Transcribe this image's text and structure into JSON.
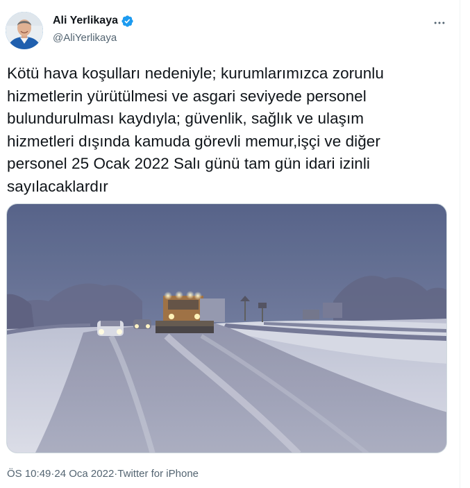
{
  "author": {
    "display_name": "Ali Yerlikaya",
    "handle": "@AliYerlikaya",
    "verified": true
  },
  "tweet": {
    "text": "Kötü hava koşulları nedeniyle; kurumlarımızca zorunlu\nhizmetlerin yürütülmesi ve asgari seviyede personel\nbulundurulması kaydıyla; güvenlik, sağlık ve ulaşım\nhizmetleri dışında kamuda görevli memur,işçi ve diğer\npersonel 25 Ocak 2022 Salı günü tam gün idari izinli\nsayılacaklardır"
  },
  "meta": {
    "time": "ÖS 10:49",
    "separator": " · ",
    "date": "24 Oca 2022",
    "source": "Twitter for iPhone"
  },
  "icons": {
    "more": "more-horizontal-icon",
    "verified": "verified-badge-icon"
  },
  "colors": {
    "text_primary": "#0f1419",
    "text_secondary": "#536471",
    "verified_blue": "#1d9bf0",
    "border": "#cfd9de"
  }
}
